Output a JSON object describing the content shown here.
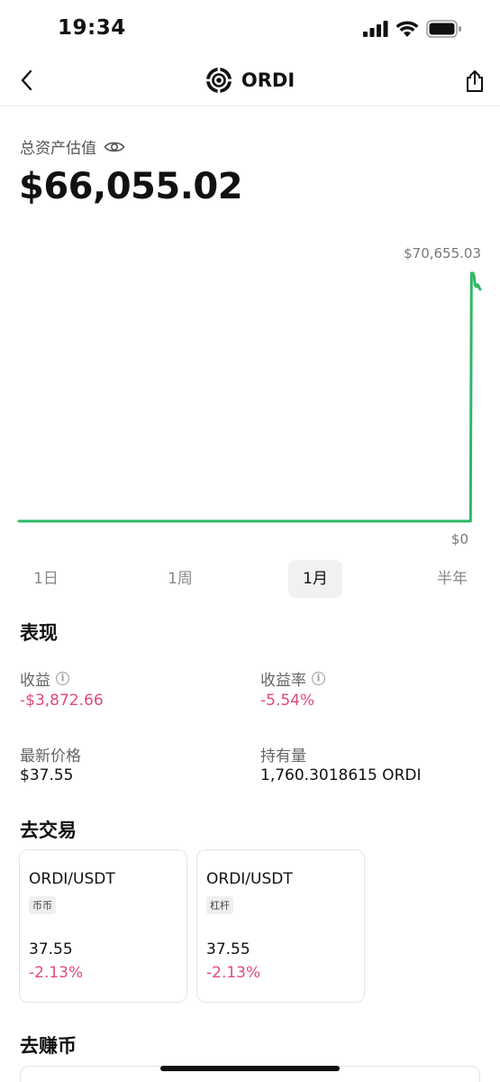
{
  "status_bar": {
    "time": "19:34"
  },
  "nav": {
    "title": "ORDI"
  },
  "asset": {
    "label": "总资产估值",
    "value": "$66,055.02"
  },
  "chart_data": {
    "type": "line",
    "color": "#2fb865",
    "max_label": "$70,655.03",
    "min_label": "$0",
    "ylim": [
      0,
      70655.03
    ],
    "values": [
      0,
      0,
      0,
      0,
      0,
      0,
      0,
      0,
      0,
      0,
      0,
      0,
      0,
      0,
      0,
      0,
      0,
      0,
      0,
      0,
      0,
      0,
      0,
      0,
      0,
      0,
      0,
      0,
      0,
      0,
      0,
      0,
      0,
      0,
      0,
      0,
      0,
      0,
      0,
      0,
      0,
      0,
      0,
      0,
      0,
      0,
      0,
      0,
      0,
      0,
      0,
      0,
      0,
      0,
      0,
      0,
      0,
      0,
      0,
      0,
      0,
      0,
      0,
      0,
      0,
      0,
      0,
      0,
      0,
      0,
      0,
      0,
      0,
      0,
      0,
      0,
      0,
      0,
      0,
      0,
      0,
      0,
      0,
      0,
      0,
      0,
      0,
      0,
      0,
      0,
      0,
      0,
      0,
      0,
      0,
      0,
      0,
      0,
      0,
      0,
      0,
      0,
      0,
      0,
      0,
      0,
      0,
      0,
      0,
      0,
      0,
      0,
      0,
      0,
      0,
      0,
      0,
      0,
      0,
      0,
      0,
      0,
      0,
      0,
      0,
      0,
      0,
      0,
      0,
      0,
      0,
      0,
      0,
      0,
      0,
      0,
      0,
      0,
      0,
      0,
      0,
      0,
      0,
      0,
      0,
      0,
      0,
      0,
      0,
      0,
      0,
      0,
      0,
      0,
      0,
      0,
      0,
      0,
      0,
      0,
      0,
      0,
      0,
      0,
      0,
      0,
      0,
      0,
      0,
      0,
      0,
      0,
      0,
      0,
      0,
      0,
      0,
      0,
      0,
      0,
      0,
      0,
      0,
      0,
      0,
      0,
      0,
      0,
      0,
      0,
      0,
      0,
      0,
      0,
      0,
      0,
      0,
      0,
      0,
      0,
      0,
      0,
      0,
      0,
      0,
      0,
      0,
      0,
      0,
      0,
      0,
      0,
      0,
      0,
      0,
      0,
      0,
      0,
      0,
      0,
      0,
      0,
      0,
      0,
      0,
      0,
      0,
      0,
      0,
      0,
      0,
      0,
      0,
      0,
      0,
      0,
      0,
      0,
      0,
      0,
      0,
      0,
      0,
      0,
      0,
      0,
      0,
      0,
      0,
      0,
      0,
      0,
      0,
      0,
      0,
      0,
      0,
      0,
      0,
      0,
      0,
      0,
      0,
      0,
      0,
      0,
      0,
      0,
      0,
      0,
      0,
      0,
      0,
      0,
      0,
      0,
      0,
      0,
      0,
      0,
      0,
      0,
      0,
      0,
      0,
      0,
      0,
      0,
      0,
      0,
      0,
      0,
      0,
      0,
      0,
      0,
      0,
      0,
      0,
      0,
      0,
      0,
      0,
      0,
      0,
      0,
      0,
      0,
      0,
      0,
      0,
      0,
      0,
      0,
      0,
      0,
      0,
      0,
      0,
      0,
      0,
      0,
      0,
      0,
      0,
      0,
      0,
      0,
      0,
      0,
      0,
      0,
      0,
      0,
      0,
      0,
      0,
      0,
      0,
      0,
      0,
      0,
      0,
      0,
      0,
      0,
      0,
      0,
      0,
      0,
      0,
      0,
      0,
      0,
      0,
      0,
      0,
      0,
      0,
      0,
      0,
      0,
      0,
      0,
      0,
      0,
      0,
      0,
      0,
      0,
      0,
      0,
      0,
      0,
      0,
      0,
      0,
      0,
      0,
      0,
      0,
      0,
      0,
      0,
      0,
      0,
      0,
      0,
      0,
      0,
      0,
      0,
      0,
      0,
      0,
      0,
      0,
      0,
      0,
      0,
      0,
      0,
      0,
      0,
      0,
      0,
      0,
      0,
      0,
      0,
      0,
      0,
      0,
      0,
      0,
      0,
      0,
      0,
      0,
      0,
      0,
      0,
      0,
      0,
      0,
      0,
      0,
      0,
      0,
      0,
      0,
      0,
      0,
      0,
      0,
      0,
      0,
      0,
      0,
      0,
      0,
      0,
      0,
      0,
      0,
      0,
      0,
      0,
      0,
      0,
      0,
      0,
      0,
      0,
      0,
      0,
      0,
      0,
      0,
      0,
      0,
      0,
      0,
      0,
      0,
      0,
      0,
      0,
      0,
      0,
      0,
      0,
      0,
      0,
      0,
      0,
      0,
      0,
      0,
      0,
      0,
      0,
      0,
      0,
      0,
      0,
      0,
      0,
      0,
      0,
      0,
      0,
      0,
      0,
      0,
      0,
      0,
      0,
      0,
      0,
      0,
      0,
      0,
      0,
      0,
      0,
      0,
      0,
      0,
      0,
      0,
      0,
      0,
      0,
      0,
      0,
      0,
      70655.03,
      70655.03,
      70655.03,
      69800,
      67300,
      67000,
      66800,
      67400,
      67000,
      66500,
      66055.02
    ]
  },
  "range_tabs": [
    {
      "label": "1日"
    },
    {
      "label": "1周"
    },
    {
      "label": "1月",
      "active": true
    },
    {
      "label": "半年"
    }
  ],
  "performance": {
    "title": "表现",
    "pnl_label": "收益",
    "pnl_value": "-$3,872.66",
    "pnl_rate_label": "收益率",
    "pnl_rate_value": "-5.54%",
    "last_price_label": "最新价格",
    "last_price_value": "$37.55",
    "holdings_label": "持有量",
    "holdings_value": "1,760.3018615 ORDI"
  },
  "trade": {
    "title": "去交易",
    "cards": [
      {
        "pair": "ORDI/USDT",
        "tag": "币币",
        "price": "37.55",
        "change": "-2.13%"
      },
      {
        "pair": "ORDI/USDT",
        "tag": "杠杆",
        "price": "37.55",
        "change": "-2.13%"
      }
    ]
  },
  "earn": {
    "title": "去赚币"
  }
}
